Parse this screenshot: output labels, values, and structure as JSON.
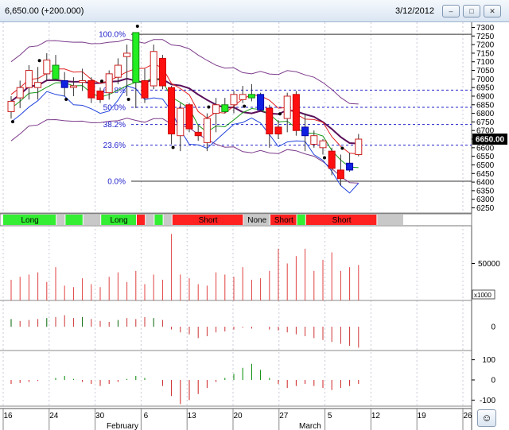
{
  "window": {
    "title": "6,650.00 (+200.000)",
    "date": "3/12/2012",
    "buttons": [
      "minimize-icon",
      "restore-icon",
      "close-icon"
    ]
  },
  "chart_data": [
    {
      "type": "candlestick",
      "yticks": [
        6250,
        6300,
        6350,
        6400,
        6450,
        6500,
        6550,
        6600,
        6650,
        6700,
        6750,
        6800,
        6850,
        6900,
        6950,
        7000,
        7050,
        7100,
        7150,
        7200,
        7250,
        7300
      ],
      "ylim": [
        6220,
        7330
      ],
      "last_price_label": "6650.00",
      "fib_levels": [
        {
          "label": "100.0%",
          "value": 7260
        },
        {
          "label": "61.8%",
          "value": 6935
        },
        {
          "label": "50.0%",
          "value": 6835
        },
        {
          "label": "38.2%",
          "value": 6735
        },
        {
          "label": "23.6%",
          "value": 6615
        },
        {
          "label": "0.0%",
          "value": 6405
        }
      ],
      "candles": [
        {
          "o": 6810,
          "h": 6900,
          "l": 6770,
          "c": 6870,
          "color": "white"
        },
        {
          "o": 6890,
          "h": 6990,
          "l": 6830,
          "c": 6950,
          "color": "white"
        },
        {
          "o": 6950,
          "h": 7080,
          "l": 6880,
          "c": 7050,
          "color": "white"
        },
        {
          "o": 6950,
          "h": 7070,
          "l": 6880,
          "c": 6980,
          "color": "white"
        },
        {
          "o": 7030,
          "h": 7150,
          "l": 6990,
          "c": 7110,
          "color": "white"
        },
        {
          "o": 7080,
          "h": 7140,
          "l": 6990,
          "c": 7000,
          "color": "green"
        },
        {
          "o": 6990,
          "h": 7040,
          "l": 6900,
          "c": 6950,
          "color": "blue"
        },
        {
          "o": 6960,
          "h": 7010,
          "l": 6900,
          "c": 6960,
          "color": "white"
        },
        {
          "o": 6980,
          "h": 7060,
          "l": 6930,
          "c": 6990,
          "color": "white"
        },
        {
          "o": 6990,
          "h": 7010,
          "l": 6860,
          "c": 6890,
          "color": "red"
        },
        {
          "o": 6930,
          "h": 6950,
          "l": 6860,
          "c": 6880,
          "color": "red"
        },
        {
          "o": 6920,
          "h": 7050,
          "l": 6880,
          "c": 7030,
          "color": "white"
        },
        {
          "o": 7010,
          "h": 7120,
          "l": 6970,
          "c": 7080,
          "color": "white"
        },
        {
          "o": 7150,
          "h": 7200,
          "l": 6900,
          "c": 7130,
          "color": "white"
        },
        {
          "o": 7270,
          "h": 7270,
          "l": 6830,
          "c": 6980,
          "color": "green"
        },
        {
          "o": 6990,
          "h": 7060,
          "l": 6860,
          "c": 6890,
          "color": "red"
        },
        {
          "o": 6960,
          "h": 7200,
          "l": 6940,
          "c": 7160,
          "color": "white"
        },
        {
          "o": 7120,
          "h": 7140,
          "l": 6940,
          "c": 6960,
          "color": "red"
        },
        {
          "o": 6950,
          "h": 6960,
          "l": 6620,
          "c": 6680,
          "color": "red"
        },
        {
          "o": 6670,
          "h": 6860,
          "l": 6580,
          "c": 6830,
          "color": "white"
        },
        {
          "o": 6850,
          "h": 6860,
          "l": 6690,
          "c": 6710,
          "color": "red"
        },
        {
          "o": 6690,
          "h": 6730,
          "l": 6640,
          "c": 6670,
          "color": "red"
        },
        {
          "o": 6630,
          "h": 6800,
          "l": 6580,
          "c": 6770,
          "color": "white"
        },
        {
          "o": 6800,
          "h": 6890,
          "l": 6690,
          "c": 6850,
          "color": "white"
        },
        {
          "o": 6850,
          "h": 6890,
          "l": 6800,
          "c": 6810,
          "color": "green"
        },
        {
          "o": 6850,
          "h": 6930,
          "l": 6800,
          "c": 6910,
          "color": "white"
        },
        {
          "o": 6910,
          "h": 6960,
          "l": 6860,
          "c": 6880,
          "color": "white"
        },
        {
          "o": 6910,
          "h": 6970,
          "l": 6870,
          "c": 6890,
          "color": "green"
        },
        {
          "o": 6910,
          "h": 6920,
          "l": 6820,
          "c": 6820,
          "color": "blue"
        },
        {
          "o": 6830,
          "h": 6850,
          "l": 6600,
          "c": 6680,
          "color": "red"
        },
        {
          "o": 6720,
          "h": 6760,
          "l": 6650,
          "c": 6680,
          "color": "red"
        },
        {
          "o": 6770,
          "h": 6920,
          "l": 6690,
          "c": 6900,
          "color": "white"
        },
        {
          "o": 6910,
          "h": 6930,
          "l": 6670,
          "c": 6700,
          "color": "red"
        },
        {
          "o": 6720,
          "h": 6800,
          "l": 6580,
          "c": 6670,
          "color": "blue"
        },
        {
          "o": 6620,
          "h": 6700,
          "l": 6600,
          "c": 6670,
          "color": "white"
        },
        {
          "o": 6640,
          "h": 6650,
          "l": 6560,
          "c": 6600,
          "color": "white"
        },
        {
          "o": 6580,
          "h": 6600,
          "l": 6440,
          "c": 6480,
          "color": "red"
        },
        {
          "o": 6470,
          "h": 6560,
          "l": 6380,
          "c": 6420,
          "color": "red"
        },
        {
          "o": 6510,
          "h": 6570,
          "l": 6460,
          "c": 6470,
          "color": "blue"
        },
        {
          "o": 6560,
          "h": 6680,
          "l": 6550,
          "c": 6650,
          "color": "white"
        }
      ],
      "signal_band": [
        {
          "label": "Long",
          "color": "#33ee33",
          "span": [
            0,
            6
          ]
        },
        {
          "label": "",
          "color": "#c8c8c8",
          "span": [
            6,
            7
          ]
        },
        {
          "label": "",
          "color": "#33ee33",
          "span": [
            7,
            9
          ]
        },
        {
          "label": "",
          "color": "#c8c8c8",
          "span": [
            9,
            11
          ]
        },
        {
          "label": "Long",
          "color": "#33ee33",
          "span": [
            11,
            15
          ]
        },
        {
          "label": "",
          "color": "#ff2020",
          "span": [
            15,
            16
          ]
        },
        {
          "label": "",
          "color": "#c8c8c8",
          "span": [
            16,
            17
          ]
        },
        {
          "label": "",
          "color": "#33ee33",
          "span": [
            17,
            18
          ]
        },
        {
          "label": "",
          "color": "#c8c8c8",
          "span": [
            18,
            19
          ]
        },
        {
          "label": "Short",
          "color": "#ff2020",
          "span": [
            19,
            27
          ]
        },
        {
          "label": "None",
          "color": "#c8c8c8",
          "span": [
            27,
            30
          ]
        },
        {
          "label": "Short",
          "color": "#ff2020",
          "span": [
            30,
            33
          ]
        },
        {
          "label": "",
          "color": "#33ee33",
          "span": [
            33,
            34
          ]
        },
        {
          "label": "Short",
          "color": "#ff2020",
          "span": [
            34,
            42
          ]
        },
        {
          "label": "",
          "color": "#c8c8c8",
          "span": [
            42,
            45
          ]
        }
      ],
      "volume": {
        "yticks": [
          50000
        ],
        "multiplier_label": "x1000",
        "values": [
          28,
          32,
          35,
          38,
          25,
          45,
          20,
          18,
          30,
          22,
          18,
          32,
          38,
          25,
          40,
          22,
          35,
          28,
          90,
          35,
          30,
          22,
          20,
          38,
          35,
          32,
          45,
          28,
          30,
          40,
          70,
          50,
          60,
          70,
          40,
          55,
          65,
          40,
          45,
          48
        ]
      },
      "oscillator1": {
        "yticks": [
          0
        ],
        "values": [
          8,
          6,
          7,
          8,
          9,
          10,
          12,
          9,
          10,
          8,
          6,
          5,
          7,
          9,
          8,
          10,
          9,
          7,
          -3,
          -6,
          -8,
          -12,
          -10,
          -6,
          -5,
          -3,
          -1,
          -2,
          0,
          -3,
          -4,
          -6,
          -8,
          -10,
          -12,
          -14,
          -16,
          -18,
          -20,
          -22
        ]
      },
      "oscillator2": {
        "yticks": [
          100,
          0,
          -100
        ],
        "values": [
          -20,
          -15,
          -10,
          -5,
          0,
          10,
          20,
          5,
          -10,
          -20,
          -30,
          -20,
          -10,
          5,
          20,
          10,
          0,
          -30,
          -80,
          -120,
          -100,
          -70,
          -40,
          -10,
          10,
          30,
          60,
          80,
          50,
          10,
          -20,
          -40,
          -30,
          -20,
          -30,
          -40,
          -50,
          -40,
          -30,
          -20
        ]
      },
      "x_axis": {
        "day_labels": [
          "16",
          "24",
          "30",
          "6",
          "13",
          "20",
          "27",
          "5",
          "12",
          "19",
          "26"
        ],
        "month_labels": [
          "February",
          "March"
        ]
      }
    }
  ]
}
